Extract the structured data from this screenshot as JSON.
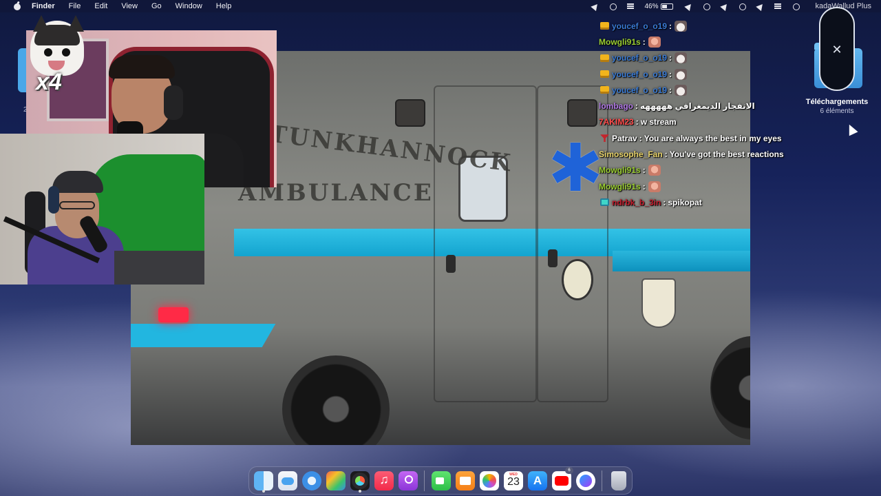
{
  "menubar": {
    "app_name": "Finder",
    "menus": [
      "File",
      "Edit",
      "View",
      "Go",
      "Window",
      "Help"
    ],
    "battery_percent": "46%",
    "user_label": "kadaWallud Plus"
  },
  "desktop": {
    "folder_name": "Téléchargements",
    "folder_count": "6 éléments",
    "left_icon_fragment": "2"
  },
  "overlay": {
    "cat_multiplier": "x4"
  },
  "video": {
    "vehicle_text_line1": "TUNKHANNOCK",
    "vehicle_text_line2": "AMBULANCE"
  },
  "chat": {
    "messages": [
      {
        "user": "youcef_o_o19",
        "user_color": "#3a7bd5",
        "badge": "crown",
        "text": "",
        "emote": "cat"
      },
      {
        "user": "Mowgli91s",
        "user_color": "#9acd32",
        "badge": "",
        "text": "",
        "emote": "face"
      },
      {
        "user": "youcef_o_o19",
        "user_color": "#3a7bd5",
        "badge": "crown",
        "text": "",
        "emote": "cat"
      },
      {
        "user": "youcef_o_o19",
        "user_color": "#3a7bd5",
        "badge": "crown",
        "text": "",
        "emote": "cat"
      },
      {
        "user": "youcef_o_o19",
        "user_color": "#3a7bd5",
        "badge": "crown",
        "text": "",
        "emote": "cat"
      },
      {
        "user": "lombago",
        "user_color": "#b27ae6",
        "badge": "",
        "text": "الانفجار الديمغرافي هههههه",
        "emote": ""
      },
      {
        "user": "7AKIM23",
        "user_color": "#ff4b4b",
        "badge": "",
        "text": "w stream",
        "emote": ""
      },
      {
        "user": "Patrav",
        "user_color": "#ffffff",
        "badge": "mod",
        "text": "You are always the best in my eyes",
        "emote": ""
      },
      {
        "user": "Simosophe_Fan",
        "user_color": "#e8d36a",
        "badge": "",
        "text": "You've got the best reactions",
        "emote": ""
      },
      {
        "user": "Mowgli91s",
        "user_color": "#9acd32",
        "badge": "",
        "text": "",
        "emote": "face"
      },
      {
        "user": "Mowgli91s",
        "user_color": "#9acd32",
        "badge": "",
        "text": "",
        "emote": "face"
      },
      {
        "user": "ndrbk_b_3in",
        "user_color": "#c21c2b",
        "badge": "bits",
        "text": "spikopat",
        "emote": ""
      }
    ]
  },
  "dock": {
    "items": [
      "finder",
      "icloud",
      "safari",
      "launchpad",
      "davinci-resolve",
      "music",
      "podcasts",
      "facetime",
      "books",
      "photos",
      "calendar",
      "app-store",
      "youtube",
      "messenger",
      "trash"
    ],
    "calendar_month": "WED",
    "calendar_day": "23",
    "youtube_badge": "6"
  }
}
